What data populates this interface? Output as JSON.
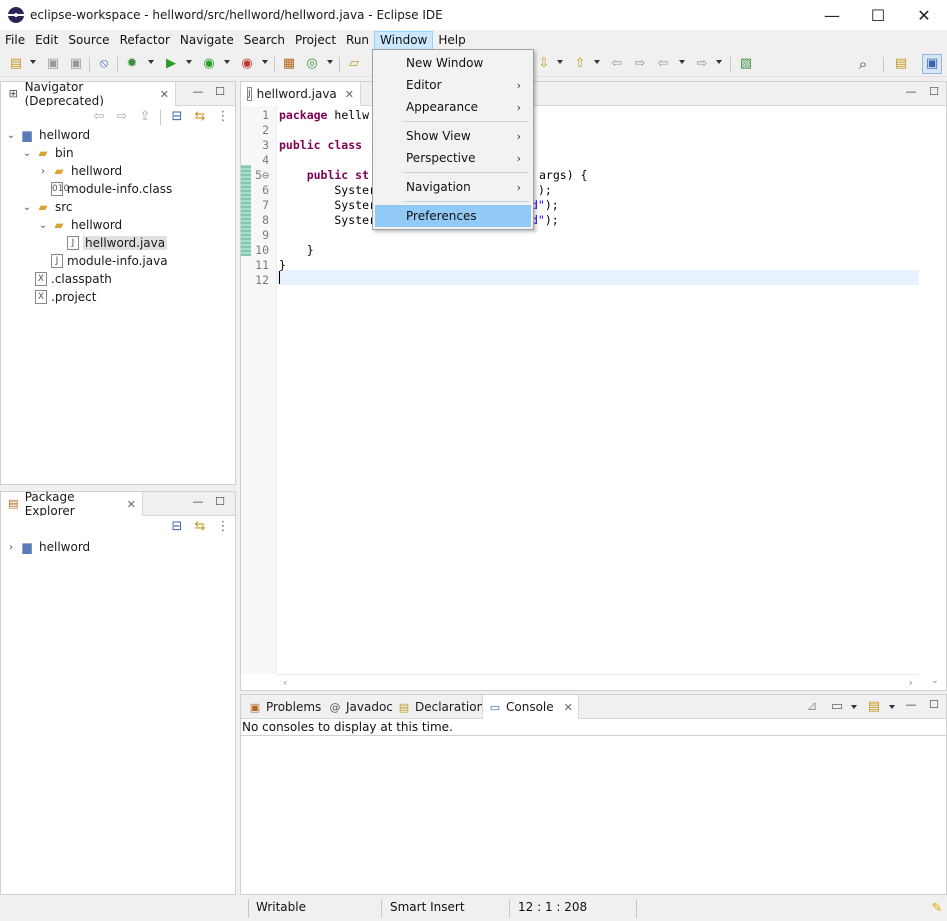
{
  "window": {
    "title": "eclipse-workspace - hellword/src/hellword/hellword.java - Eclipse IDE",
    "minimize": "—",
    "maximize": "☐",
    "close": "✕"
  },
  "menubar": {
    "items": [
      "File",
      "Edit",
      "Source",
      "Refactor",
      "Navigate",
      "Search",
      "Project",
      "Run",
      "Window",
      "Help"
    ],
    "active": "Window"
  },
  "window_menu": {
    "items": [
      {
        "label": "New Window",
        "submenu": false
      },
      {
        "label": "Editor",
        "submenu": true
      },
      {
        "label": "Appearance",
        "submenu": true
      },
      {
        "label": "Show View",
        "submenu": true
      },
      {
        "label": "Perspective",
        "submenu": true
      },
      {
        "label": "Navigation",
        "submenu": true
      },
      {
        "label": "Preferences",
        "submenu": false,
        "highlighted": true
      }
    ],
    "arrow_glyph": "›"
  },
  "navigator": {
    "tab_label": "Navigator (Deprecated)",
    "tree": [
      {
        "label": "hellword",
        "icon": "project-icon",
        "twisty": "⌄"
      },
      {
        "label": "bin",
        "icon": "folder-icon",
        "twisty": "⌄"
      },
      {
        "label": "hellword",
        "icon": "folder-icon",
        "twisty": "›"
      },
      {
        "label": "module-info.class",
        "icon": "class-file-icon",
        "twisty": ""
      },
      {
        "label": "src",
        "icon": "folder-icon",
        "twisty": "⌄"
      },
      {
        "label": "hellword",
        "icon": "folder-icon",
        "twisty": "⌄"
      },
      {
        "label": "hellword.java",
        "icon": "java-file-icon",
        "twisty": "",
        "selected": true
      },
      {
        "label": "module-info.java",
        "icon": "java-file-icon",
        "twisty": ""
      },
      {
        "label": ".classpath",
        "icon": "xml-file-icon",
        "twisty": ""
      },
      {
        "label": ".project",
        "icon": "xml-file-icon",
        "twisty": ""
      }
    ]
  },
  "package_explorer": {
    "tab_label": "Package Explorer",
    "tree": [
      {
        "label": "hellword",
        "icon": "project-icon",
        "twisty": "›"
      }
    ]
  },
  "editor": {
    "tab_label": "hellword.java",
    "line_numbers": [
      "1",
      "2",
      "3",
      "4",
      "5⊖",
      "6",
      "7",
      "8",
      "9",
      "10",
      "11",
      "12"
    ],
    "lines": [
      {
        "kw": "package ",
        "rest": "hellw"
      },
      {
        "kw": "",
        "rest": ""
      },
      {
        "kw": "public class ",
        "rest": ""
      },
      {
        "kw": "",
        "rest": ""
      },
      {
        "kw": "    public st",
        "rest": "",
        "tail": "args) {"
      },
      {
        "kw": "",
        "rest": "        Syster",
        "str": ");"
      },
      {
        "kw": "",
        "rest": "        Syster",
        "str": "d\");"
      },
      {
        "kw": "",
        "rest": "        Syster",
        "str": "d\");"
      },
      {
        "kw": "",
        "rest": ""
      },
      {
        "kw": "",
        "rest": "    }"
      },
      {
        "kw": "",
        "rest": "}"
      },
      {
        "kw": "",
        "rest": ""
      }
    ]
  },
  "console": {
    "tabs": [
      {
        "label": "Problems",
        "icon": "problems-icon"
      },
      {
        "label": "Javadoc",
        "icon": "javadoc-icon"
      },
      {
        "label": "Declaration",
        "icon": "declaration-icon"
      },
      {
        "label": "Console",
        "icon": "console-icon",
        "active": true
      }
    ],
    "message": "No consoles to display at this time."
  },
  "statusbar": {
    "writable": "Writable",
    "insert_mode": "Smart Insert",
    "position": "12 : 1 : 208"
  }
}
